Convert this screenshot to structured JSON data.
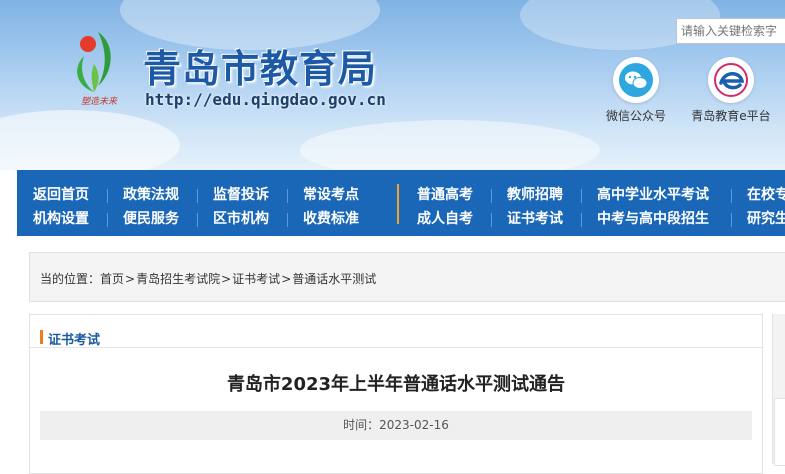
{
  "header": {
    "title": "青岛市教育局",
    "url": "http://edu.qingdao.gov.cn",
    "logo_slogan": "塑造未来",
    "search_placeholder": "请输入关键检索字",
    "wechat_label": "微信公众号",
    "eplatform_label": "青岛教育e平台"
  },
  "nav": {
    "row1": [
      "返回首页",
      "政策法规",
      "监督投诉",
      "常设考点",
      "普通高考",
      "教师招聘",
      "高中学业水平考试",
      "在校专"
    ],
    "row2": [
      "机构设置",
      "便民服务",
      "区市机构",
      "收费标准",
      "成人自考",
      "证书考试",
      "中考与高中段招生",
      "研究生"
    ]
  },
  "breadcrumb": {
    "prefix": "当的位置：",
    "items": [
      "首页",
      "青岛招生考试院",
      "证书考试",
      "普通话水平测试"
    ],
    "separator": ">"
  },
  "section": {
    "heading": "证书考试"
  },
  "article": {
    "title": "青岛市2023年上半年普通话水平测试通告",
    "time_label": "时间：",
    "time_value": "2023-02-16"
  },
  "colors": {
    "nav_bg": "#1a67b8",
    "accent_orange": "#ef7d1a",
    "title_blue": "#1d5aa6"
  }
}
